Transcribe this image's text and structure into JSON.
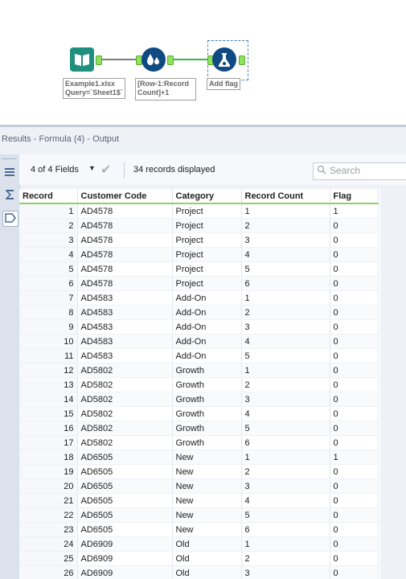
{
  "workflow": {
    "nodes": [
      {
        "name": "input-data-tool",
        "annotation": "Example1.xlsx\nQuery=`Sheet1$`"
      },
      {
        "name": "multi-row-formula-tool",
        "annotation": "[Row-1:Record\nCount]+1"
      },
      {
        "name": "formula-tool",
        "annotation": "Add flag"
      }
    ]
  },
  "results": {
    "title": "Results - Formula (4) - Output",
    "fields_selector": "4 of 4 Fields",
    "records_displayed": "34 records displayed",
    "search_placeholder": "Search",
    "columns": [
      "Record",
      "Customer Code",
      "Category",
      "Record Count",
      "Flag"
    ],
    "rows": [
      [
        "1",
        "AD4578",
        "Project",
        "1",
        "1"
      ],
      [
        "2",
        "AD4578",
        "Project",
        "2",
        "0"
      ],
      [
        "3",
        "AD4578",
        "Project",
        "3",
        "0"
      ],
      [
        "4",
        "AD4578",
        "Project",
        "4",
        "0"
      ],
      [
        "5",
        "AD4578",
        "Project",
        "5",
        "0"
      ],
      [
        "6",
        "AD4578",
        "Project",
        "6",
        "0"
      ],
      [
        "7",
        "AD4583",
        "Add-On",
        "1",
        "0"
      ],
      [
        "8",
        "AD4583",
        "Add-On",
        "2",
        "0"
      ],
      [
        "9",
        "AD4583",
        "Add-On",
        "3",
        "0"
      ],
      [
        "10",
        "AD4583",
        "Add-On",
        "4",
        "0"
      ],
      [
        "11",
        "AD4583",
        "Add-On",
        "5",
        "0"
      ],
      [
        "12",
        "AD5802",
        "Growth",
        "1",
        "0"
      ],
      [
        "13",
        "AD5802",
        "Growth",
        "2",
        "0"
      ],
      [
        "14",
        "AD5802",
        "Growth",
        "3",
        "0"
      ],
      [
        "15",
        "AD5802",
        "Growth",
        "4",
        "0"
      ],
      [
        "16",
        "AD5802",
        "Growth",
        "5",
        "0"
      ],
      [
        "17",
        "AD5802",
        "Growth",
        "6",
        "0"
      ],
      [
        "18",
        "AD6505",
        "New",
        "1",
        "1"
      ],
      [
        "19",
        "AD6505",
        "New",
        "2",
        "0"
      ],
      [
        "20",
        "AD6505",
        "New",
        "3",
        "0"
      ],
      [
        "21",
        "AD6505",
        "New",
        "4",
        "0"
      ],
      [
        "22",
        "AD6505",
        "New",
        "5",
        "0"
      ],
      [
        "23",
        "AD6505",
        "New",
        "6",
        "0"
      ],
      [
        "24",
        "AD6909",
        "Old",
        "1",
        "0"
      ],
      [
        "25",
        "AD6909",
        "Old",
        "2",
        "0"
      ],
      [
        "26",
        "AD6909",
        "Old",
        "3",
        "0"
      ]
    ]
  },
  "icons": {
    "rail": [
      "list-view-icon",
      "sigma-icon",
      "tag-icon"
    ],
    "toolbar": [
      "chevron-down-icon",
      "checkmark-icon",
      "search-icon"
    ]
  },
  "colors": {
    "accent_green": "#8fd16c",
    "node_blue": "#0f4a83",
    "node_teal": "#1f8f7e"
  }
}
